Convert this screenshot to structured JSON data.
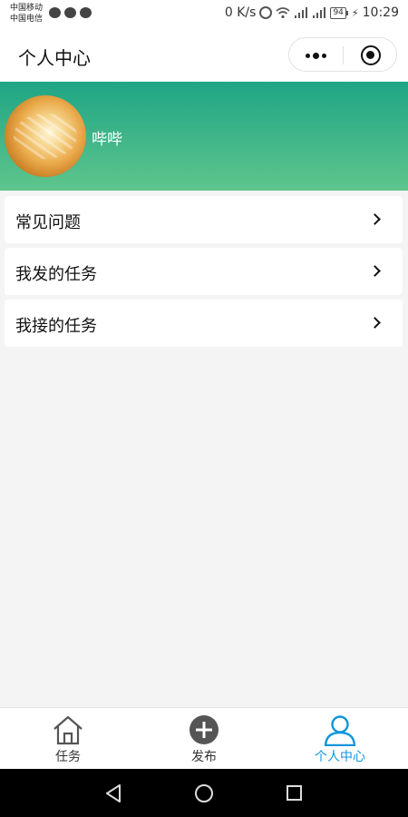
{
  "status_bar": {
    "carrier_1": "中国移动",
    "carrier_2": "中国电信",
    "net_speed": "0 K/s",
    "network_2g": "2G",
    "network_4g": "4G",
    "battery": "94",
    "time": "10:29"
  },
  "nav": {
    "title": "个人中心",
    "more_icon": "more-dots-icon",
    "close_icon": "close-circle-icon"
  },
  "profile": {
    "username": "哔哔",
    "gradient_top": "#1fa585",
    "gradient_bottom": "#5ec58c"
  },
  "menu": {
    "items": [
      {
        "label": "常见问题",
        "icon": "chevron-right-icon"
      },
      {
        "label": "我发的任务",
        "icon": "chevron-right-icon"
      },
      {
        "label": "我接的任务",
        "icon": "chevron-right-icon"
      }
    ]
  },
  "tabbar": {
    "tabs": [
      {
        "label": "任务",
        "icon": "home-icon",
        "active": false
      },
      {
        "label": "发布",
        "icon": "plus-circle-icon",
        "active": false
      },
      {
        "label": "个人中心",
        "icon": "user-icon",
        "active": true
      }
    ],
    "active_color": "#1296db",
    "inactive_color": "#333333"
  }
}
